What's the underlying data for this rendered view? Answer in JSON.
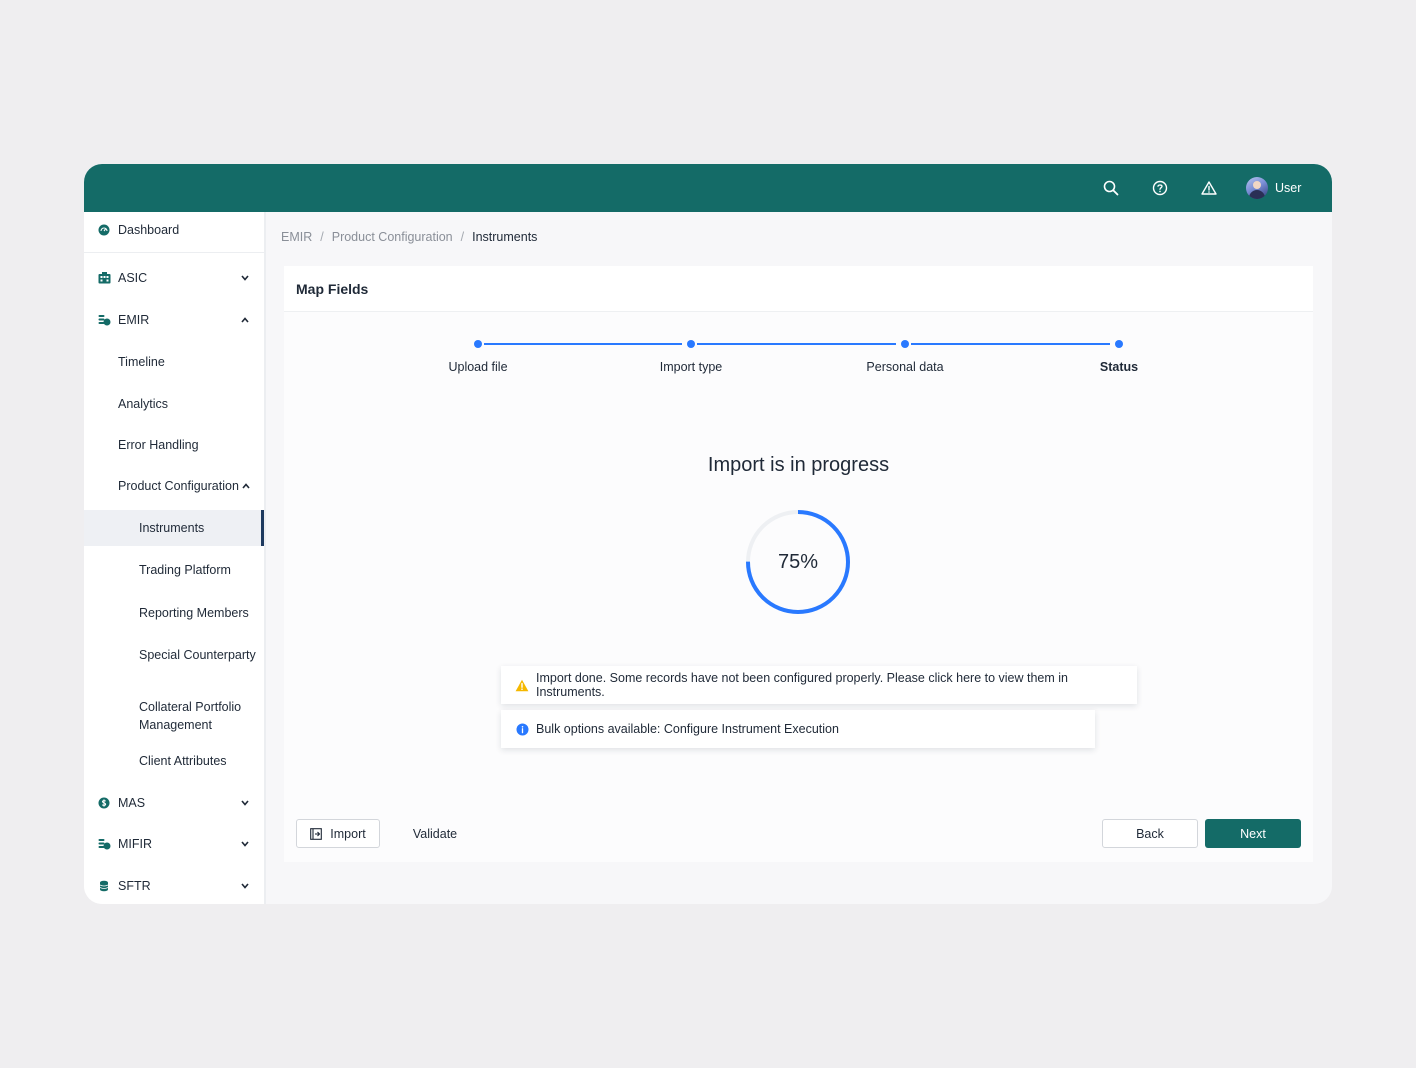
{
  "topbar": {
    "user_label": "User",
    "icons": [
      "search-icon",
      "help-icon",
      "warning-icon"
    ]
  },
  "sidebar": {
    "dashboard": "Dashboard",
    "asic": "ASIC",
    "emir": "EMIR",
    "emir_items": {
      "timeline": "Timeline",
      "analytics": "Analytics",
      "error_handling": "Error Handling",
      "product_configuration": "Product Configuration"
    },
    "product_configuration_items": {
      "instruments": "Instruments",
      "trading_platform": "Trading Platform",
      "reporting_members": "Reporting Members",
      "special_counterparty": "Special Counterparty",
      "collateral_portfolio_line1": "Collateral Portfolio",
      "collateral_portfolio_line2": "Management",
      "client_attributes": "Client Attributes"
    },
    "mas": "MAS",
    "mifir": "MIFIR",
    "sftr": "SFTR",
    "active_item": "Instruments"
  },
  "breadcrumb": {
    "level1": "EMIR",
    "level2": "Product Configuration",
    "level3": "Instruments",
    "separator": "/"
  },
  "card": {
    "title": "Map Fields"
  },
  "stepper": {
    "steps": [
      "Upload file",
      "Import type",
      "Personal data",
      "Status"
    ],
    "active_step": "Status"
  },
  "progress": {
    "title": "Import is in progress",
    "percent_label": "75%",
    "value": 0.75,
    "color": "#2979ff"
  },
  "alerts": {
    "warning": "Import done. Some records have not been configured properly. Please click here to view them in Instruments.",
    "info": "Bulk options available: Configure Instrument Execution"
  },
  "actions": {
    "import": "Import",
    "validate": "Validate",
    "back": "Back",
    "next": "Next"
  },
  "colors": {
    "brand": "#146b67",
    "accent": "#2979ff",
    "warning": "#f5b800",
    "info": "#2979ff"
  }
}
